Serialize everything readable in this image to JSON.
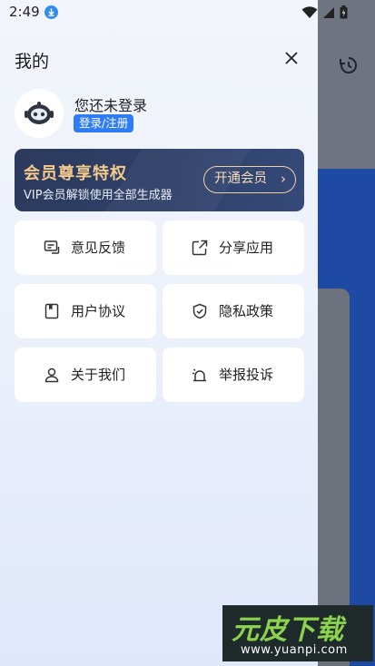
{
  "status_bar": {
    "time": "2:49"
  },
  "drawer": {
    "title": "我的",
    "user": {
      "name": "您还未登录",
      "login_label": "登录/注册"
    },
    "vip": {
      "title": "会员尊享特权",
      "subtitle": "VIP会员解锁使用全部生成器",
      "button_label": "开通会员",
      "chevron": "›"
    },
    "menu": [
      {
        "label": "意见反馈",
        "icon": "feedback-icon"
      },
      {
        "label": "分享应用",
        "icon": "share-icon"
      },
      {
        "label": "用户协议",
        "icon": "agreement-icon"
      },
      {
        "label": "隐私政策",
        "icon": "privacy-shield-icon"
      },
      {
        "label": "关于我们",
        "icon": "user-icon"
      },
      {
        "label": "举报投诉",
        "icon": "report-bell-icon"
      }
    ]
  },
  "watermark": {
    "brand": "元皮下载",
    "url": "www.yuanpi.com"
  },
  "colors": {
    "accent": "#2e7cf6",
    "vip_gold": "#f5c98c",
    "vip_bg": "#2f416a"
  }
}
